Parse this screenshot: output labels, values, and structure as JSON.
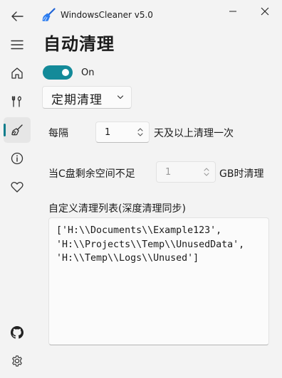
{
  "window": {
    "title": "WindowsCleaner v5.0",
    "controls": [
      "minimize",
      "close"
    ]
  },
  "nav": {
    "items": [
      {
        "icon": "back-arrow-icon"
      },
      {
        "icon": "menu-icon"
      },
      {
        "icon": "home-icon"
      },
      {
        "icon": "tools-icon"
      },
      {
        "icon": "broom-icon",
        "selected": true
      },
      {
        "icon": "info-icon"
      },
      {
        "icon": "heart-icon"
      },
      {
        "icon": "github-icon"
      },
      {
        "icon": "settings-gear-icon"
      }
    ]
  },
  "page": {
    "title": "自动清理",
    "toggle": {
      "label": "On",
      "checked": true
    },
    "mode": {
      "selected": "定期清理"
    },
    "interval": {
      "prefix": "每隔",
      "value": "1",
      "suffix": "天及以上清理一次"
    },
    "disk": {
      "prefix": "当C盘剩余空间不足",
      "value": "1",
      "suffix": "GB时清理",
      "disabled": true
    },
    "custom_list": {
      "label": "自定义清理列表(深度清理同步)",
      "value": "['H:\\\\Documents\\\\Example123', 'H:\\\\Projects\\\\Temp\\\\UnusedData', 'H:\\\\Temp\\\\Logs\\\\Unused']"
    }
  },
  "colors": {
    "accent": "#138a99",
    "background": "#f3f3f3",
    "nav_selected": "#e6e6e6"
  }
}
